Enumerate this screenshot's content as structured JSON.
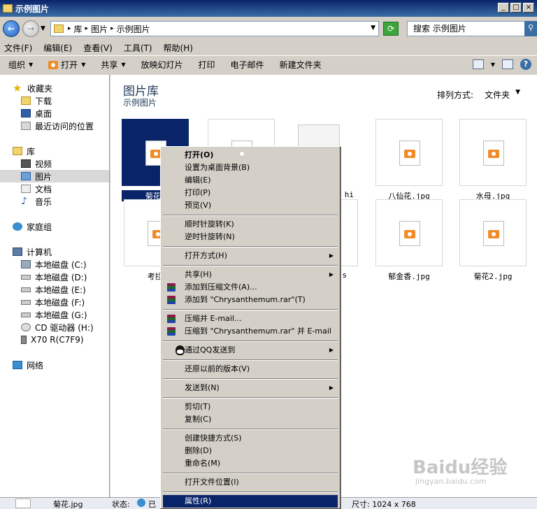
{
  "window": {
    "title": "示例图片"
  },
  "address": {
    "crumbs": [
      "库",
      "图片",
      "示例图片"
    ],
    "search_placeholder": "搜索 示例图片"
  },
  "menu": [
    "文件(F)",
    "编辑(E)",
    "查看(V)",
    "工具(T)",
    "帮助(H)"
  ],
  "commands": {
    "organize": "组织",
    "open": "打开",
    "share": "共享",
    "slideshow": "放映幻灯片",
    "print": "打印",
    "email": "电子邮件",
    "new_folder": "新建文件夹"
  },
  "nav": {
    "favorites": "收藏夹",
    "downloads": "下载",
    "desktop": "桌面",
    "recent": "最近访问的位置",
    "libraries": "库",
    "videos": "视频",
    "pictures": "图片",
    "documents": "文档",
    "music": "音乐",
    "homegroup": "家庭组",
    "computer": "计算机",
    "drive_c": "本地磁盘 (C:)",
    "drive_d": "本地磁盘 (D:)",
    "drive_e": "本地磁盘 (E:)",
    "drive_f": "本地磁盘 (F:)",
    "drive_g": "本地磁盘 (G:)",
    "drive_h": "CD 驱动器 (H:)",
    "drive_x70": "X70 R(C7F9)",
    "network": "网络"
  },
  "main": {
    "library_title": "图片库",
    "library_subtitle": "示例图片",
    "arrange_label": "排列方式:",
    "arrange_value": "文件夹",
    "files": {
      "f1": "菊花.",
      "f3": "hi",
      "f4": "八仙花.jpg",
      "f5": "水母.jpg",
      "f6": "考拉.",
      "f8": "s",
      "f9": "郁金香.jpg",
      "f10": "菊花2.jpg"
    }
  },
  "context_menu": {
    "open": "打开(O)",
    "set_wallpaper": "设置为桌面背景(B)",
    "edit": "编辑(E)",
    "print": "打印(P)",
    "preview": "预览(V)",
    "rotate_cw": "顺时针旋转(K)",
    "rotate_ccw": "逆时针旋转(N)",
    "open_with": "打开方式(H)",
    "share": "共享(H)",
    "add_archive": "添加到压缩文件(A)...",
    "add_to_rar": "添加到 \"Chrysanthemum.rar\"(T)",
    "compress_email": "压缩并 E-mail...",
    "compress_rar_email": "压缩到 \"Chrysanthemum.rar\" 并 E-mail",
    "qq_send": "通过QQ发送到",
    "restore": "还原以前的版本(V)",
    "send_to": "发送到(N)",
    "cut": "剪切(T)",
    "copy": "复制(C)",
    "create_shortcut": "创建快捷方式(S)",
    "delete": "删除(D)",
    "rename": "重命名(M)",
    "open_location": "打开文件位置(I)",
    "properties": "属性(R)"
  },
  "details": {
    "filename": "菊花.jpg",
    "state_label": "状态:",
    "state_value": "已",
    "size": "尺寸: 1024 x 768"
  },
  "watermark": {
    "main": "Baidu经验",
    "sub": "jingyan.baidu.com"
  }
}
